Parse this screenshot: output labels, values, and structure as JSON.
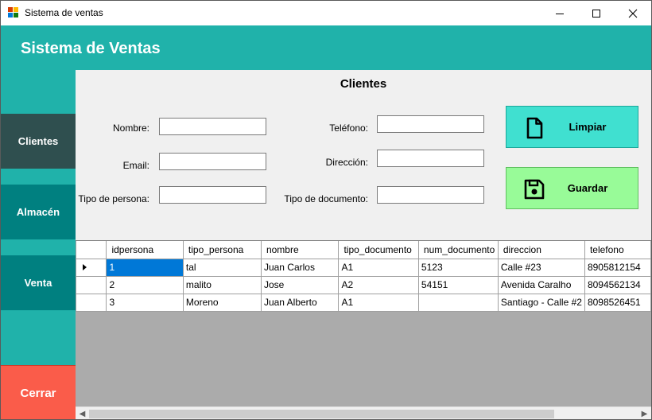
{
  "window": {
    "title": "Sistema de ventas"
  },
  "header": {
    "title": "Sistema de Ventas"
  },
  "sidebar": {
    "items": [
      {
        "label": "Clientes"
      },
      {
        "label": "Almacén"
      },
      {
        "label": "Venta"
      },
      {
        "label": "Cerrar"
      }
    ]
  },
  "form": {
    "title": "Clientes",
    "fields": {
      "nombre": {
        "label": "Nombre:",
        "value": ""
      },
      "email": {
        "label": "Email:",
        "value": ""
      },
      "tipo_persona": {
        "label": "Tipo de persona:",
        "value": ""
      },
      "telefono": {
        "label": "Teléfono:",
        "value": ""
      },
      "direccion": {
        "label": "Dirección:",
        "value": ""
      },
      "tipo_documento": {
        "label": "Tipo de documento:",
        "value": ""
      }
    },
    "buttons": {
      "limpiar": "Limpiar",
      "guardar": "Guardar"
    }
  },
  "grid": {
    "columns": [
      "idpersona",
      "tipo_persona",
      "nombre",
      "tipo_documento",
      "num_documento",
      "direccion",
      "telefono"
    ],
    "rows": [
      [
        "1",
        "tal",
        "Juan Carlos",
        "A1",
        "5123",
        "Calle #23",
        "8905812154"
      ],
      [
        "2",
        "malito",
        "Jose",
        "A2",
        "54151",
        "Avenida Caralho",
        "8094562134"
      ],
      [
        "3",
        "Moreno",
        "Juan Alberto",
        "A1",
        "",
        "Santiago - Calle #2",
        "8098526451"
      ]
    ]
  },
  "colors": {
    "header": "#20b2aa",
    "sidebar_active": "#2f4f4f",
    "sidebar_item": "#008080",
    "cerrar": "#fa5c4a",
    "limpiar": "#40e0d0",
    "guardar": "#98fb98",
    "selection": "#0078d7"
  },
  "icons": {
    "limpiar": "document-icon",
    "guardar": "save-icon"
  }
}
